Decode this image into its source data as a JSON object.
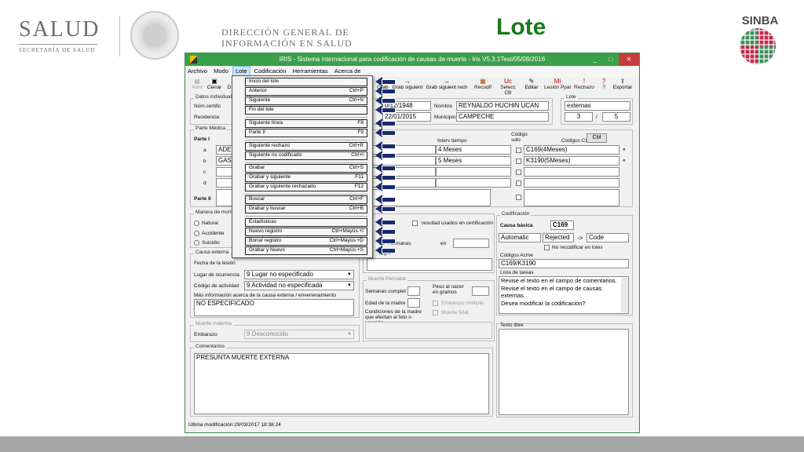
{
  "header": {
    "salud": "SALUD",
    "salud_sub": "SECRETARÍA DE SALUD",
    "dg_line1": "DIRECCIÓN GENERAL DE",
    "dg_line2": "INFORMACIÓN EN SALUD",
    "title": "Lote",
    "sinba": "SINBA"
  },
  "window": {
    "title": "IRIS - Sistema internacional para codificación de causas de muerte - Iris V5.3.1Test/05/08/2016",
    "min": "_",
    "max": "□",
    "close": "✕"
  },
  "menubar": [
    "Archivo",
    "Modo",
    "Lote",
    "Codificación",
    "Herramientas",
    "Acerca de"
  ],
  "toolbar": {
    "left": [
      {
        "label": "Abrir",
        "icon": "▤"
      },
      {
        "label": "Cerrar",
        "icon": "▣"
      },
      {
        "label": "D",
        "icon": ""
      }
    ],
    "right": [
      {
        "label": "Grab",
        "icon": "→"
      },
      {
        "label": "Grab siguient",
        "icon": "→"
      },
      {
        "label": "Grab siguient rech",
        "icon": "→"
      },
      {
        "label": "Recodif",
        "icon": "▦"
      },
      {
        "label": "Selecc CB",
        "icon": "Uc"
      },
      {
        "label": "Editar",
        "icon": "✎"
      },
      {
        "label": "Lesión Ppal",
        "icon": "Mi"
      },
      {
        "label": "Rechazo",
        "icon": "!"
      },
      {
        "label": "?",
        "icon": "?"
      },
      {
        "label": "Exportar",
        "icon": "⇪"
      }
    ]
  },
  "datos": {
    "group": "Datos individuales",
    "num_certif": "Núm.certific",
    "residencia": "Residencia",
    "fecha_nac": "0/12/1948",
    "fecha_def": "22/01/2015",
    "nombre_lbl": "Nombre",
    "nombre": "REYNALDO HUCHIN UCAN",
    "municipio_lbl": "Municipio",
    "municipio": "CAMPECHE"
  },
  "lote": {
    "group": "Lote",
    "name": "externas",
    "current": "3",
    "sep": "/",
    "total": "5"
  },
  "parte_medica": {
    "group": "Parte Médica",
    "parte1": "Parte I",
    "parte2": "Parte II",
    "rows": [
      "a",
      "b",
      "c",
      "d"
    ],
    "lines": [
      "ADEN",
      "GAST",
      "",
      ""
    ],
    "interv_hdr": "Interv tiempo",
    "codigo_solo": "Código solo",
    "codigos_cie": "Códigos CIE-10",
    "cm": "CM",
    "intervals": [
      "4 Meses",
      "5 Meses",
      "",
      ""
    ],
    "codes": [
      "C169(4Meses)",
      "K3190(5Meses)",
      "",
      ""
    ],
    "marks": [
      "«",
      "«"
    ]
  },
  "manera": {
    "group": "Manera de morir",
    "options": [
      "Natural",
      "Accidente",
      "Suicidio"
    ],
    "resultado": "resultad usados en certificación",
    "semanas": "as 4 semanas",
    "en": "en",
    "cirugia": "rugía",
    "le": "e"
  },
  "causa_ext": {
    "group": "Causa externa",
    "fecha_lesion": "Fecha de la lesión",
    "lugar": "Lugar de ocurrencia",
    "lugar_val": "9 Lugar no especificado",
    "actividad": "Código de actividad",
    "actividad_val": "9 Actividad no especificada",
    "mas_info": "Más información acerca de la causa externa / envenenamiento",
    "mas_info_val": "NO ESPECIFICADO"
  },
  "perinatal": {
    "group": "Muerte Perinatal",
    "semanas": "Semanas complet",
    "peso": "Peso al nacer en gramos",
    "edad_madre": "Edad de la madre",
    "embarazo_multiple": "Embarazo múltiple",
    "muerte_fetal": "Muerte fetal",
    "condiciones": "Condiciones de la madre que afectan al feto o r.nacido"
  },
  "materna": {
    "group": "Muerte materna",
    "embarazo": "Embarazo",
    "embarazo_val": "9 Desconocido"
  },
  "comentarios": {
    "group": "Comentarios",
    "text": "PRESUNTA MUERTE EXTERNA"
  },
  "codificacion": {
    "group": "Codificación",
    "causa_basica": "Causa básica",
    "causa_basica_val": "C169",
    "automatic": "Automatic",
    "rejected": "Rejected",
    "arrow": "->",
    "code": "Code",
    "no_recod": "No recodificar en lotes",
    "acme": "Códigos Acme",
    "acme_val": "C169/K3190",
    "lista": "Lista de tareas",
    "tasks": [
      "Revise el texto en el campo de comentarios.",
      "Revise el texto en el campo de causas externas.",
      "Desea modificar la codificación?"
    ],
    "texto_libre": "Texto libre"
  },
  "status": "Última modificación:29/03/2017 18:38:24",
  "menu": {
    "items": [
      {
        "label": "Inicio del lote",
        "shortcut": ""
      },
      {
        "label": "Anterior",
        "shortcut": "Ctrl+P"
      },
      {
        "label": "Siguiente",
        "shortcut": "Ctrl+N"
      },
      {
        "label": "Fin del lote",
        "shortcut": ""
      },
      {
        "label": "Siguiente línea",
        "shortcut": "F8"
      },
      {
        "label": "Parte II",
        "shortcut": "F9"
      },
      {
        "label": "Siguiente rechazo",
        "shortcut": "Ctrl+R"
      },
      {
        "label": "Siguiente no codificado",
        "shortcut": "Ctrl+I"
      },
      {
        "label": "Grabar",
        "shortcut": "Ctrl+S"
      },
      {
        "label": "Grabar y siguiente",
        "shortcut": "F11"
      },
      {
        "label": "Grabar y siguiente rechazado",
        "shortcut": "F12"
      },
      {
        "label": "Buscar",
        "shortcut": "Ctrl+F"
      },
      {
        "label": "Grabar y buscar",
        "shortcut": "Ctrl+B"
      },
      {
        "label": "Estadísticas",
        "shortcut": ""
      },
      {
        "label": "Nuevo registro",
        "shortcut": "Ctrl+Mayús.+I"
      },
      {
        "label": "Borrar registro",
        "shortcut": "Ctrl+Mayús.+D"
      },
      {
        "label": "Grabar y Nuevo",
        "shortcut": "Ctrl+Mayús.+S"
      }
    ]
  }
}
